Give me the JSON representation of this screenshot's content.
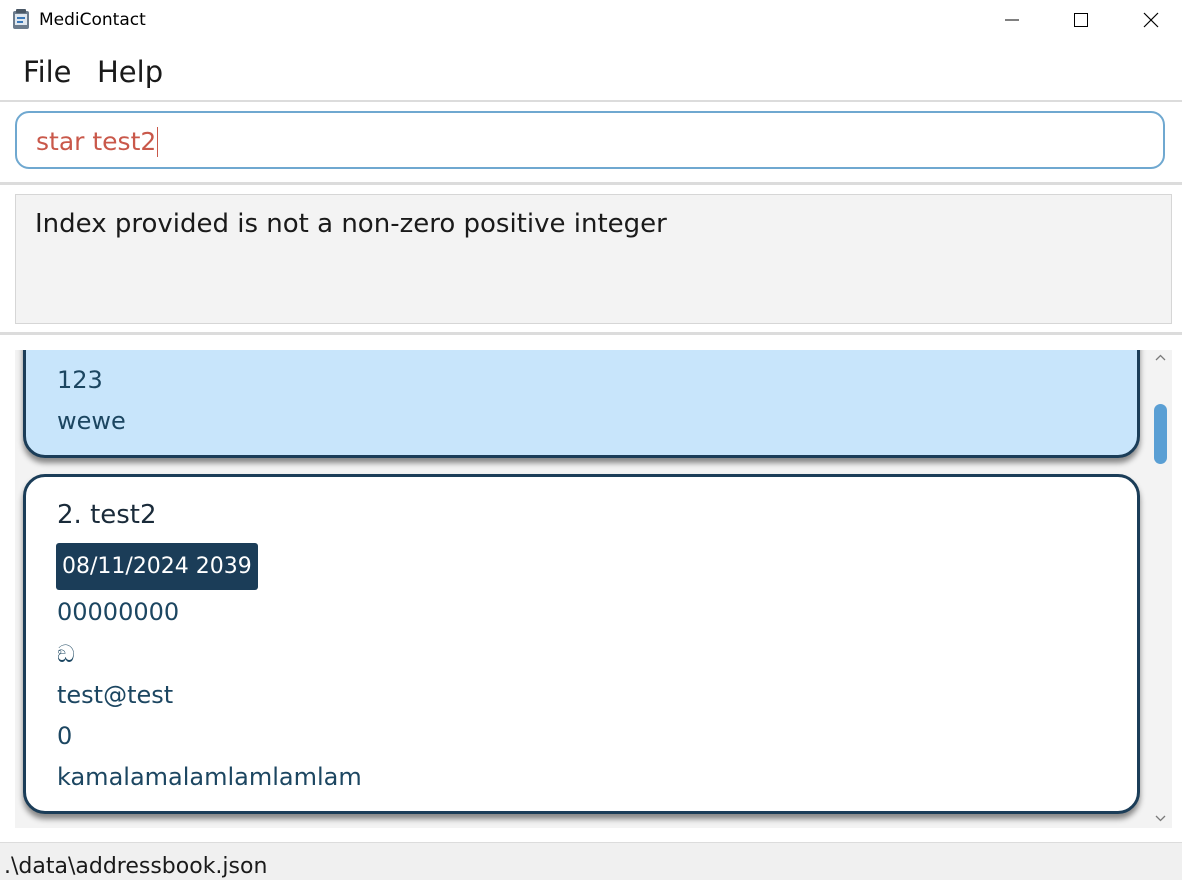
{
  "window": {
    "title": "MediContact",
    "icons": {
      "app": "app-icon",
      "minimize": "minimize-icon",
      "maximize": "maximize-icon",
      "close": "close-icon"
    }
  },
  "menu": {
    "file_label": "File",
    "help_label": "Help"
  },
  "command": {
    "value": "star test2",
    "text_color": "#c9584a",
    "border_color": "#6fa8d0"
  },
  "result": {
    "message": "Index provided is not a non-zero positive integer"
  },
  "persons": [
    {
      "selected": true,
      "lines": [
        "123",
        "wewe"
      ]
    },
    {
      "selected": false,
      "title": "2. test2",
      "tag": "08/11/2024 2039",
      "lines": [
        "00000000",
        "ඞ",
        "test@test",
        "0",
        "kamalamalamlamlamlam"
      ]
    }
  ],
  "colors": {
    "selected_card": "#c8e5fb",
    "card_border": "#1b3d58",
    "tag_bg": "#1b3d58",
    "field_text": "#1c4661",
    "scroll_thumb": "#5a9fd4"
  },
  "scrollbar": {
    "up_icon": "chevron-up-icon",
    "down_icon": "chevron-down-icon"
  },
  "status": {
    "file_path": ".\\data\\addressbook.json"
  }
}
